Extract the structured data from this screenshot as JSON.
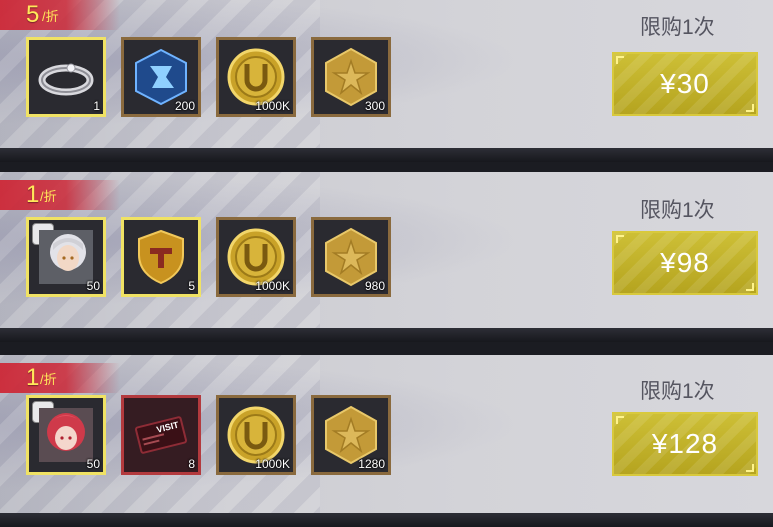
{
  "offers": [
    {
      "discount": {
        "value": "5",
        "unit": "/折"
      },
      "limit_text": "限购1次",
      "price": "¥30",
      "items": [
        {
          "icon": "ring-icon",
          "count": "1",
          "frame": "gold"
        },
        {
          "icon": "blue-core-icon",
          "count": "200",
          "frame": "bronze"
        },
        {
          "icon": "gold-coin-icon",
          "count": "1000K",
          "frame": "bronze"
        },
        {
          "icon": "gold-star-hexagon-icon",
          "count": "300",
          "frame": "bronze"
        }
      ]
    },
    {
      "discount": {
        "value": "1",
        "unit": "/折"
      },
      "limit_text": "限购1次",
      "price": "¥98",
      "items": [
        {
          "icon": "silver-hair-character-icon",
          "count": "50",
          "frame": "gold"
        },
        {
          "icon": "gold-shield-icon",
          "count": "5",
          "frame": "gold"
        },
        {
          "icon": "gold-coin-icon",
          "count": "1000K",
          "frame": "bronze"
        },
        {
          "icon": "gold-star-hexagon-icon",
          "count": "980",
          "frame": "bronze"
        }
      ]
    },
    {
      "discount": {
        "value": "1",
        "unit": "/折"
      },
      "limit_text": "限购1次",
      "price": "¥128",
      "items": [
        {
          "icon": "red-hair-character-icon",
          "count": "50",
          "frame": "gold"
        },
        {
          "icon": "visit-ticket-icon",
          "count": "8",
          "frame": "red",
          "ticket_text": "VISIT"
        },
        {
          "icon": "gold-coin-icon",
          "count": "1000K",
          "frame": "bronze"
        },
        {
          "icon": "gold-star-hexagon-icon",
          "count": "1280",
          "frame": "bronze"
        }
      ]
    }
  ],
  "colors": {
    "accent_gold": "#cdbf36",
    "discount_red": "#cd2837",
    "frame_gold": "#f0e264",
    "frame_bronze": "#8a6a3e"
  }
}
